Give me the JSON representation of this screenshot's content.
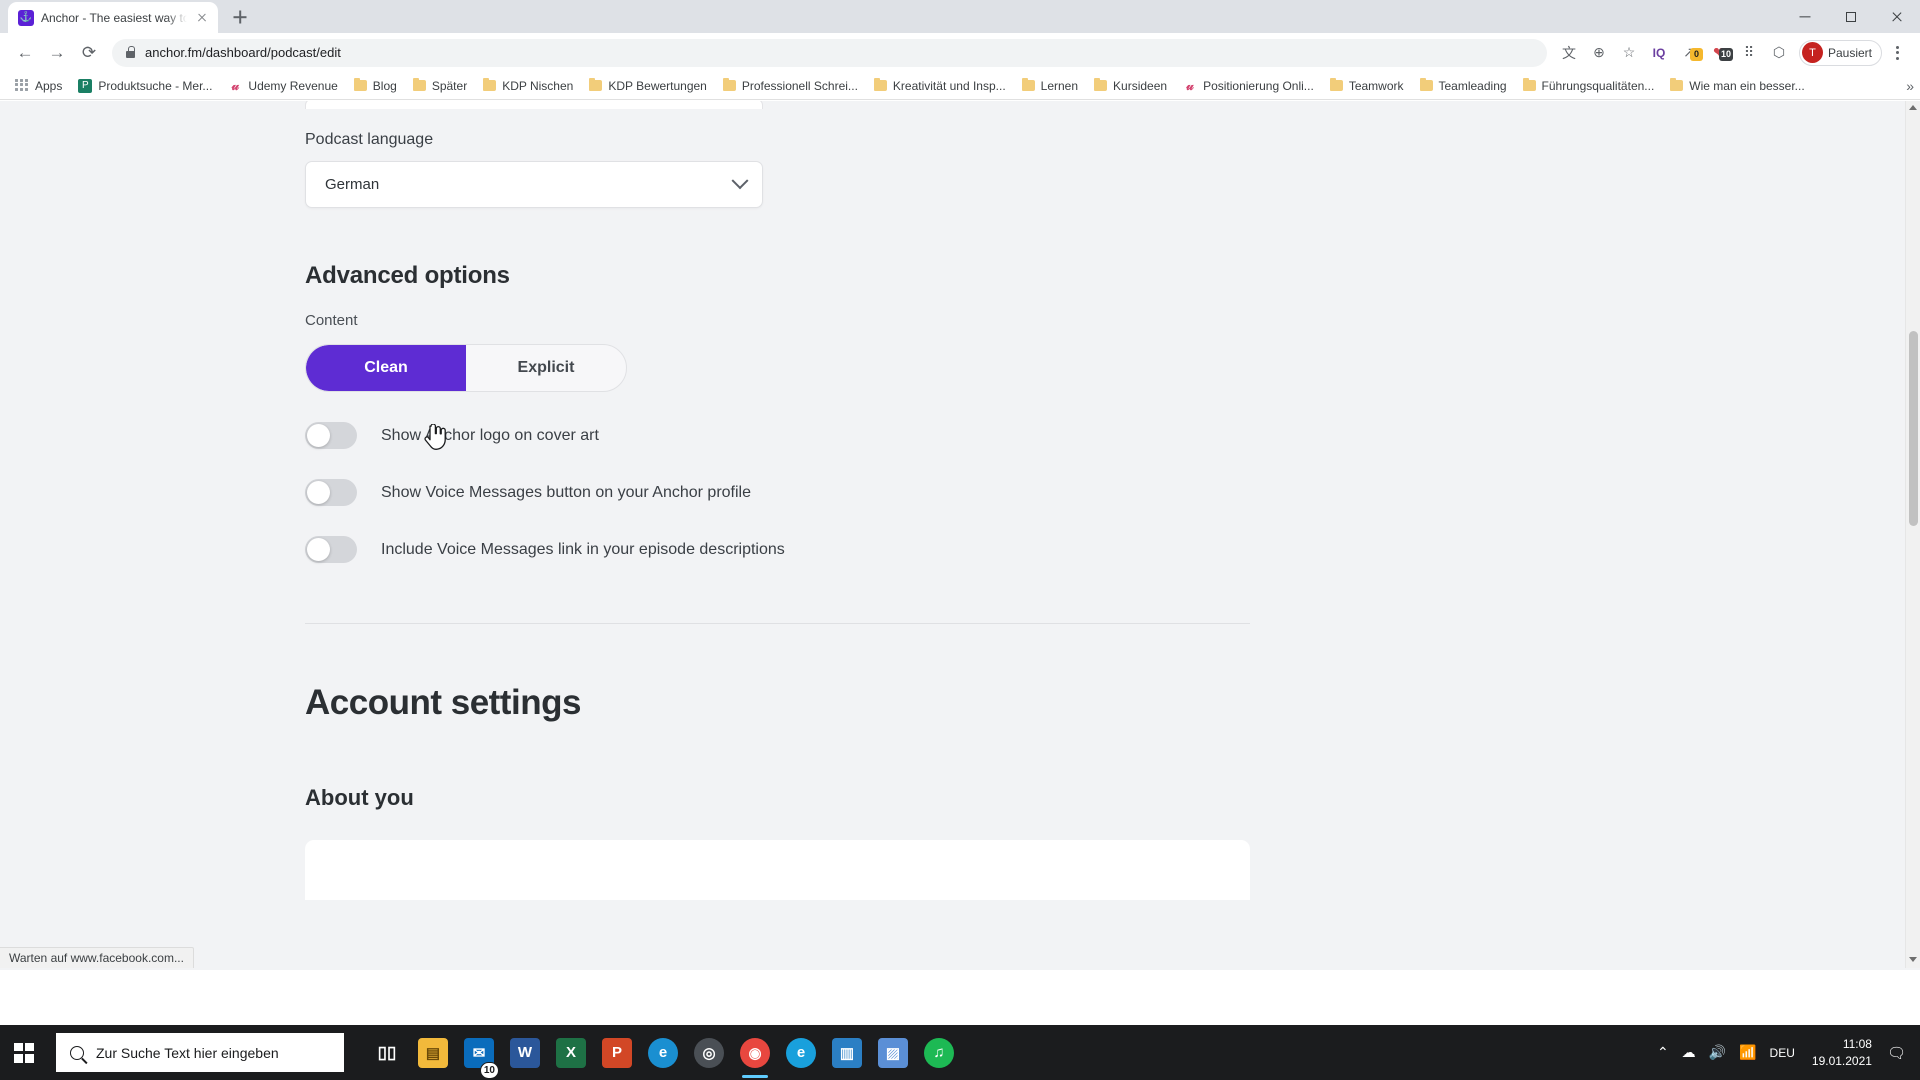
{
  "browser": {
    "tab": {
      "title": "Anchor - The easiest way to mak",
      "favicon": "anchor-icon",
      "close": "×"
    },
    "newtab_label": "+",
    "window_controls": {
      "minimize": "–",
      "maximize": "□",
      "close": "×"
    },
    "nav": {
      "back": "←",
      "forward": "→",
      "reload": "⟳"
    },
    "omnibox": {
      "url": "anchor.fm/dashboard/podcast/edit",
      "lock": "lock-icon"
    },
    "toolbar_icons": [
      {
        "name": "translate-icon",
        "glyph": "文",
        "badge": null,
        "badge_color": null
      },
      {
        "name": "zoom-icon",
        "glyph": "⊕",
        "badge": null,
        "badge_color": null
      },
      {
        "name": "bookmark-star-icon",
        "glyph": "☆",
        "badge": null,
        "badge_color": null
      },
      {
        "name": "iq-extension-icon",
        "glyph": "IQ",
        "badge": null,
        "badge_color": null
      },
      {
        "name": "grammarly-extension-icon",
        "glyph": "↗",
        "badge": "0",
        "badge_color": "#f5b82e"
      },
      {
        "name": "pocket-extension-icon",
        "glyph": "❤",
        "badge": "10",
        "badge_color": "#3c4043"
      },
      {
        "name": "extensions-icon",
        "glyph": "⠿",
        "badge": null,
        "badge_color": null
      },
      {
        "name": "puzzle-icon",
        "glyph": "🧩",
        "badge": null,
        "badge_color": null
      }
    ],
    "profile": {
      "initial": "T",
      "label": "Pausiert",
      "color": "#c5221f"
    },
    "menu_icon": "kebab-menu-icon",
    "bookmarks": [
      {
        "label": "Apps",
        "icon": "apps-grid-icon"
      },
      {
        "label": "Produktsuche - Mer...",
        "icon": "site-icon",
        "color": "#1a7f64",
        "glyph": "P"
      },
      {
        "label": "Udemy Revenue",
        "icon": "udemy-icon",
        "color": "#ffffff",
        "glyph": "U"
      },
      {
        "label": "Blog",
        "icon": "folder-icon"
      },
      {
        "label": "Später",
        "icon": "folder-icon"
      },
      {
        "label": "KDP Nischen",
        "icon": "folder-icon"
      },
      {
        "label": "KDP Bewertungen",
        "icon": "folder-icon"
      },
      {
        "label": "Professionell Schrei...",
        "icon": "folder-icon"
      },
      {
        "label": "Kreativität und Insp...",
        "icon": "folder-icon"
      },
      {
        "label": "Lernen",
        "icon": "folder-icon"
      },
      {
        "label": "Kursideen",
        "icon": "folder-icon"
      },
      {
        "label": "Positionierung Onli...",
        "icon": "udemy-icon",
        "color": "#ffffff",
        "glyph": "U"
      },
      {
        "label": "Teamwork",
        "icon": "folder-icon"
      },
      {
        "label": "Teamleading",
        "icon": "folder-icon"
      },
      {
        "label": "Führungsqualitäten...",
        "icon": "folder-icon"
      },
      {
        "label": "Wie man ein besser...",
        "icon": "folder-icon"
      }
    ],
    "bookmarks_overflow": "»",
    "status_text": "Warten auf www.facebook.com..."
  },
  "page": {
    "podcast_language": {
      "label": "Podcast language",
      "value": "German",
      "chevron": "chevron-down-icon"
    },
    "advanced_options": {
      "heading": "Advanced options",
      "content_label": "Content",
      "segments": [
        {
          "label": "Clean",
          "active": true
        },
        {
          "label": "Explicit",
          "active": false
        }
      ],
      "accent_color": "#5e2cd3",
      "toggles": [
        {
          "label": "Show Anchor logo on cover art",
          "on": false
        },
        {
          "label": "Show Voice Messages button on your Anchor profile",
          "on": false
        },
        {
          "label": "Include Voice Messages link in your episode descriptions",
          "on": false
        }
      ]
    },
    "account_settings": {
      "heading": "Account settings"
    },
    "about_you": {
      "heading": "About you"
    }
  },
  "taskbar": {
    "start": "windows-start-icon",
    "search_placeholder": "Zur Suche Text hier eingeben",
    "apps": [
      {
        "name": "task-view-icon",
        "glyph": "▤",
        "color": "#1b1c1e",
        "badge": null,
        "running": false
      },
      {
        "name": "file-explorer-icon",
        "glyph": "📁",
        "color": "#f2b93b",
        "badge": null,
        "running": false
      },
      {
        "name": "mail-icon",
        "glyph": "✉",
        "color": "#0a6cbc",
        "badge": "10",
        "running": false
      },
      {
        "name": "word-icon",
        "glyph": "W",
        "color": "#2b579a",
        "badge": null,
        "running": false
      },
      {
        "name": "excel-icon",
        "glyph": "X",
        "color": "#1e7145",
        "badge": null,
        "running": false
      },
      {
        "name": "powerpoint-icon",
        "glyph": "P",
        "color": "#d24726",
        "badge": null,
        "running": false
      },
      {
        "name": "edge-icon",
        "glyph": "e",
        "color": "#1a8fd1",
        "badge": null,
        "running": false
      },
      {
        "name": "cd-burner-icon",
        "glyph": "◎",
        "color": "#4a4f55",
        "badge": null,
        "running": false
      },
      {
        "name": "chrome-icon",
        "glyph": "◉",
        "color": "#e8473f",
        "badge": null,
        "running": true
      },
      {
        "name": "edge-chromium-icon",
        "glyph": "e",
        "color": "#19a0dc",
        "badge": null,
        "running": false
      },
      {
        "name": "outlook-news-icon",
        "glyph": "▥",
        "color": "#2b7fc4",
        "badge": null,
        "running": false
      },
      {
        "name": "photos-icon",
        "glyph": "▨",
        "color": "#5b8fd6",
        "badge": null,
        "running": false
      },
      {
        "name": "spotify-icon",
        "glyph": "♫",
        "color": "#1db954",
        "badge": null,
        "running": false
      }
    ],
    "tray": {
      "overflow": "⌃",
      "cloud": "☁",
      "volume": "🔊",
      "network": "📶",
      "language": "DEU",
      "time": "11:08",
      "date": "19.01.2021",
      "notifications": "🗨"
    }
  }
}
